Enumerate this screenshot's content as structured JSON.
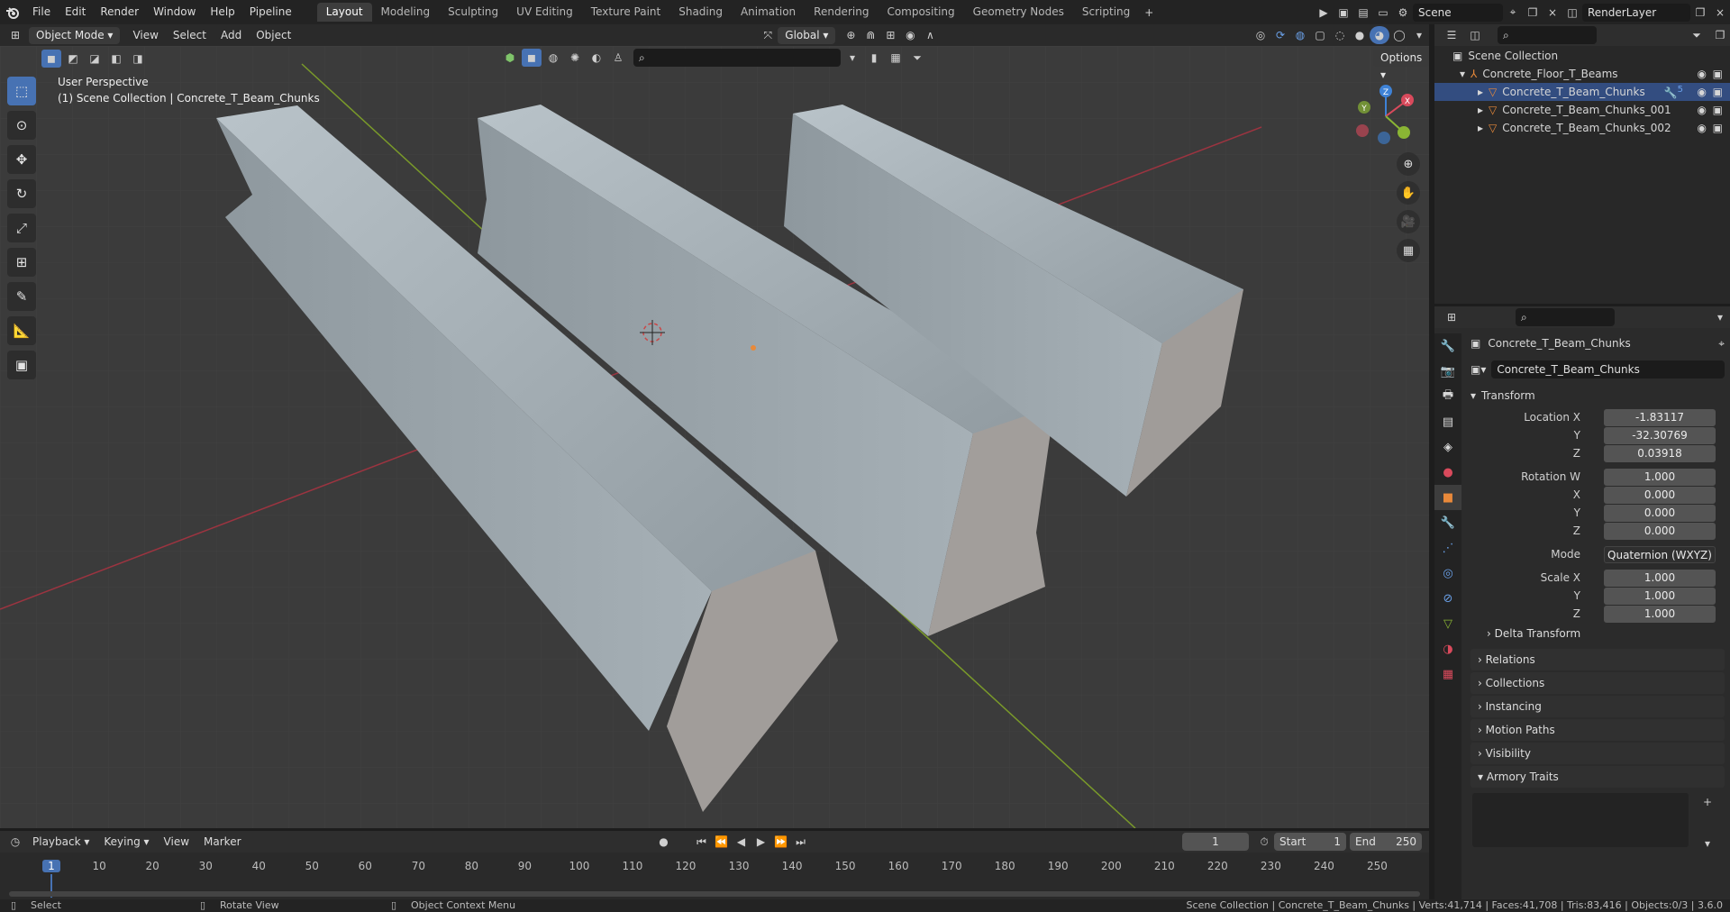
{
  "topmenu": {
    "file": "File",
    "edit": "Edit",
    "render": "Render",
    "window": "Window",
    "help": "Help",
    "pipeline": "Pipeline"
  },
  "workspaces": [
    "Layout",
    "Modeling",
    "Sculpting",
    "UV Editing",
    "Texture Paint",
    "Shading",
    "Animation",
    "Rendering",
    "Compositing",
    "Geometry Nodes",
    "Scripting"
  ],
  "scene": {
    "name": "Scene",
    "view_layer": "RenderLayer"
  },
  "viewport_header": {
    "mode": "Object Mode",
    "view": "View",
    "select": "Select",
    "add": "Add",
    "object": "Object",
    "orientation": "Global",
    "options": "Options"
  },
  "viewport": {
    "perspective": "User Perspective",
    "context": "(1) Scene Collection | Concrete_T_Beam_Chunks",
    "gizmo_axes": [
      "X",
      "Y",
      "Z"
    ]
  },
  "outliner": {
    "root": "Scene Collection",
    "collection": "Concrete_Floor_T_Beams",
    "items": [
      "Concrete_T_Beam_Chunks",
      "Concrete_T_Beam_Chunks_001",
      "Concrete_T_Beam_Chunks_002"
    ],
    "modifier_count": "5"
  },
  "properties": {
    "object_name": "Concrete_T_Beam_Chunks",
    "data_name": "Concrete_T_Beam_Chunks",
    "transform_label": "Transform",
    "location_label": "Location X",
    "location": [
      "-1.83117",
      "-32.30769",
      "0.03918"
    ],
    "rotation_label": "Rotation W",
    "rotation": [
      "1.000",
      "0.000",
      "0.000",
      "0.000"
    ],
    "mode_label": "Mode",
    "rotation_mode": "Quaternion (WXYZ)",
    "scale_label": "Scale X",
    "scale": [
      "1.000",
      "1.000",
      "1.000"
    ],
    "axis_y": "Y",
    "axis_z": "Z",
    "axis_x": "X",
    "delta": "Delta Transform",
    "panels": [
      "Relations",
      "Collections",
      "Instancing",
      "Motion Paths",
      "Visibility",
      "Armory Traits"
    ]
  },
  "timeline": {
    "playback": "Playback",
    "keying": "Keying",
    "view": "View",
    "marker": "Marker",
    "current_frame": "1",
    "start_label": "Start",
    "start": "1",
    "end_label": "End",
    "end": "250",
    "ticks": [
      "1",
      "10",
      "20",
      "30",
      "40",
      "50",
      "60",
      "70",
      "80",
      "90",
      "100",
      "110",
      "120",
      "130",
      "140",
      "150",
      "160",
      "170",
      "180",
      "190",
      "200",
      "210",
      "220",
      "230",
      "240",
      "250"
    ]
  },
  "status": {
    "select": "Select",
    "rotate": "Rotate View",
    "context_menu": "Object Context Menu",
    "stats": "Scene Collection | Concrete_T_Beam_Chunks | Verts:41,714 | Faces:41,708 | Tris:83,416 | Objects:0/3 | 3.6.0"
  },
  "colors": {
    "accent": "#4772b3",
    "orange": "#e8893a",
    "x_axis": "#d94a5c",
    "y_axis": "#8ab534",
    "z_axis": "#3e82d6"
  }
}
